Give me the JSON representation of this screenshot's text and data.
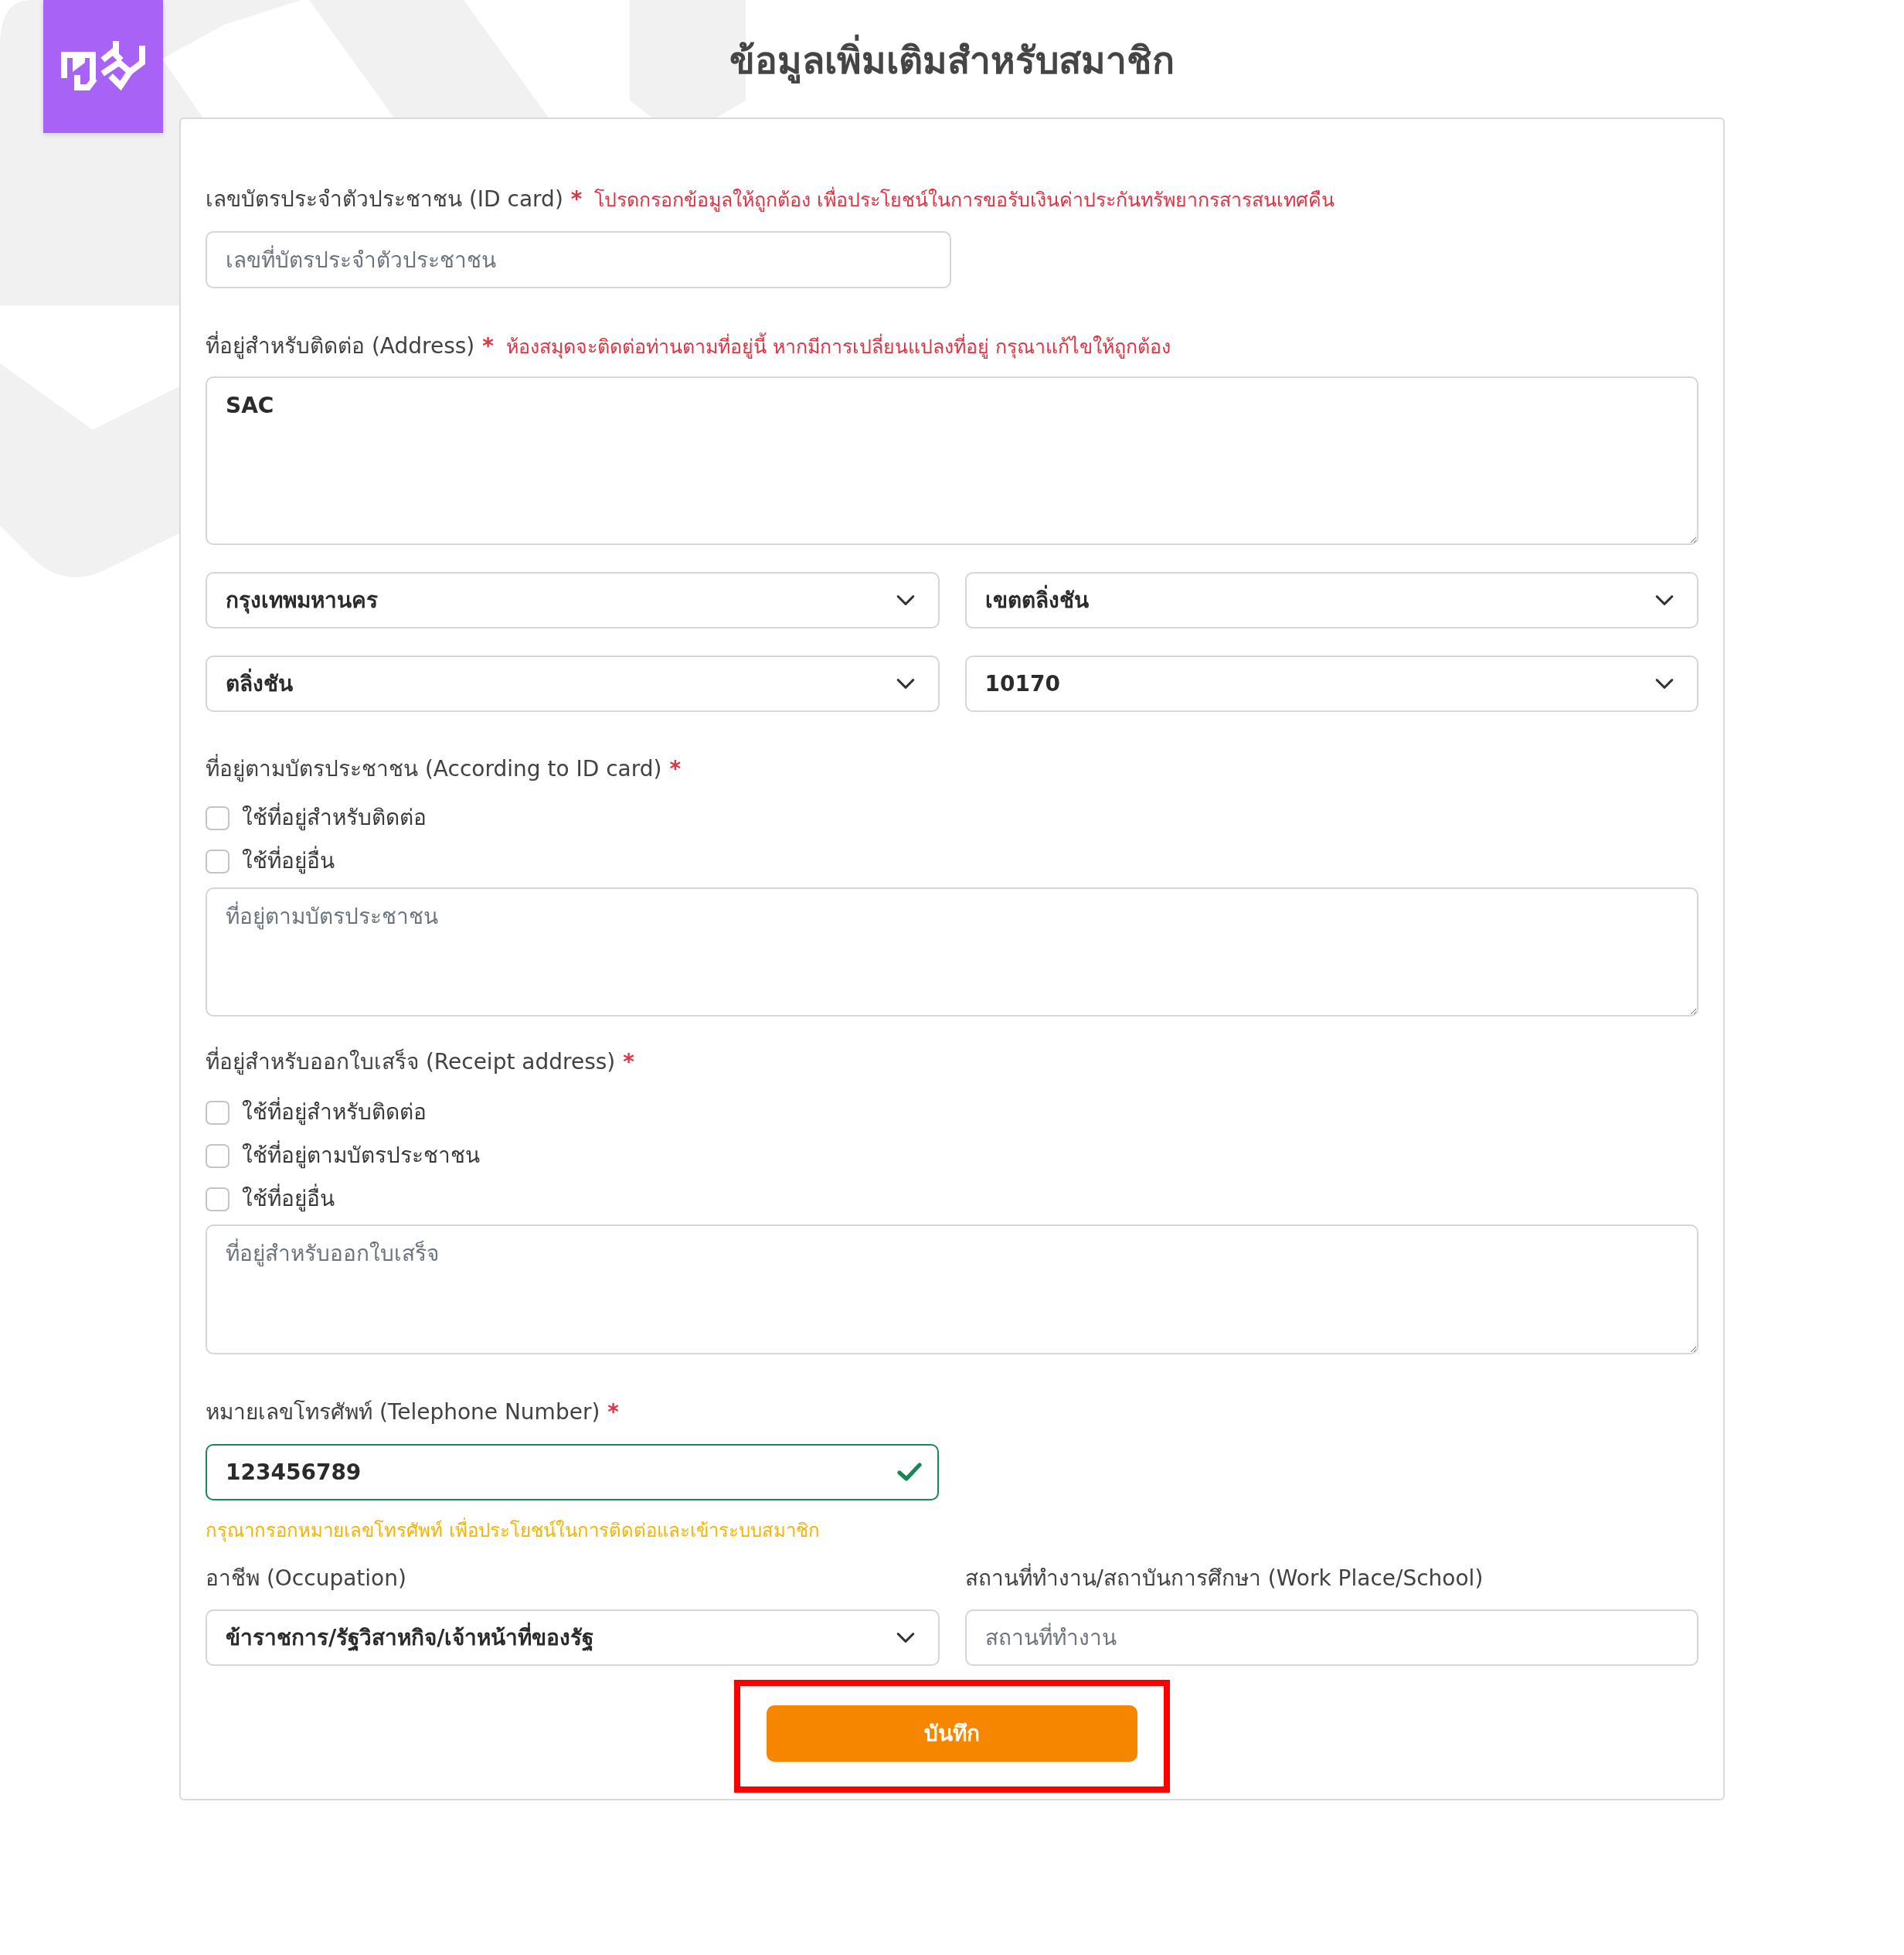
{
  "title": "ข้อมูลเพิ่มเติมสำหรับสมาชิก",
  "form": {
    "id_card": {
      "label": "เลขบัตรประจำตัวประชาชน (ID card)",
      "required_mark": "*",
      "note": "โปรดกรอกข้อมูลให้ถูกต้อง เพื่อประโยชน์ในการขอรับเงินค่าประกันทรัพยากรสารสนเทศคืน",
      "placeholder": "เลขที่บัตรประจำตัวประชาชน"
    },
    "contact_address": {
      "label": "ที่อยู่สำหรับติดต่อ (Address)",
      "required_mark": "*",
      "note": "ห้องสมุดจะติดต่อท่านตามที่อยู่นี้ หากมีการเปลี่ยนแปลงที่อยู่ กรุณาแก้ไขให้ถูกต้อง",
      "value": "SAC",
      "selects": [
        {
          "value": "กรุงเทพมหานคร"
        },
        {
          "value": "เขตตลิ่งชัน"
        },
        {
          "value": "ตลิ่งชัน"
        },
        {
          "value": "10170"
        }
      ]
    },
    "id_address": {
      "label": "ที่อยู่ตามบัตรประชาชน (According to ID card)",
      "required_mark": "*",
      "options": [
        {
          "label": "ใช้ที่อยู่สำหรับติดต่อ",
          "checked": false
        },
        {
          "label": "ใช้ที่อยู่อื่น",
          "checked": false
        }
      ],
      "placeholder": "ที่อยู่ตามบัตรประชาชน"
    },
    "receipt_address": {
      "label": "ที่อยู่สำหรับออกใบเสร็จ (Receipt address)",
      "required_mark": "*",
      "options": [
        {
          "label": "ใช้ที่อยู่สำหรับติดต่อ",
          "checked": false
        },
        {
          "label": "ใช้ที่อยู่ตามบัตรประชาชน",
          "checked": false
        },
        {
          "label": "ใช้ที่อยู่อื่น",
          "checked": false
        }
      ],
      "placeholder": "ที่อยู่สำหรับออกใบเสร็จ"
    },
    "telephone": {
      "label": "หมายเลขโทรศัพท์ (Telephone Number)",
      "required_mark": "*",
      "value": "123456789",
      "valid": true,
      "help": "กรุณากรอกหมายเลขโทรศัพท์ เพื่อประโยชน์ในการติดต่อและเข้าระบบสมาชิก"
    },
    "occupation": {
      "label": "อาชีพ (Occupation)",
      "value": "ข้าราชการ/รัฐวิสาหกิจ/เจ้าหน้าที่ของรัฐ"
    },
    "workplace": {
      "label": "สถานที่ทำงาน/สถาบันการศึกษา (Work Place/School)",
      "placeholder": "สถานที่ทำงาน"
    },
    "save_button": {
      "label": "บันทึก",
      "highlighted": true
    }
  }
}
